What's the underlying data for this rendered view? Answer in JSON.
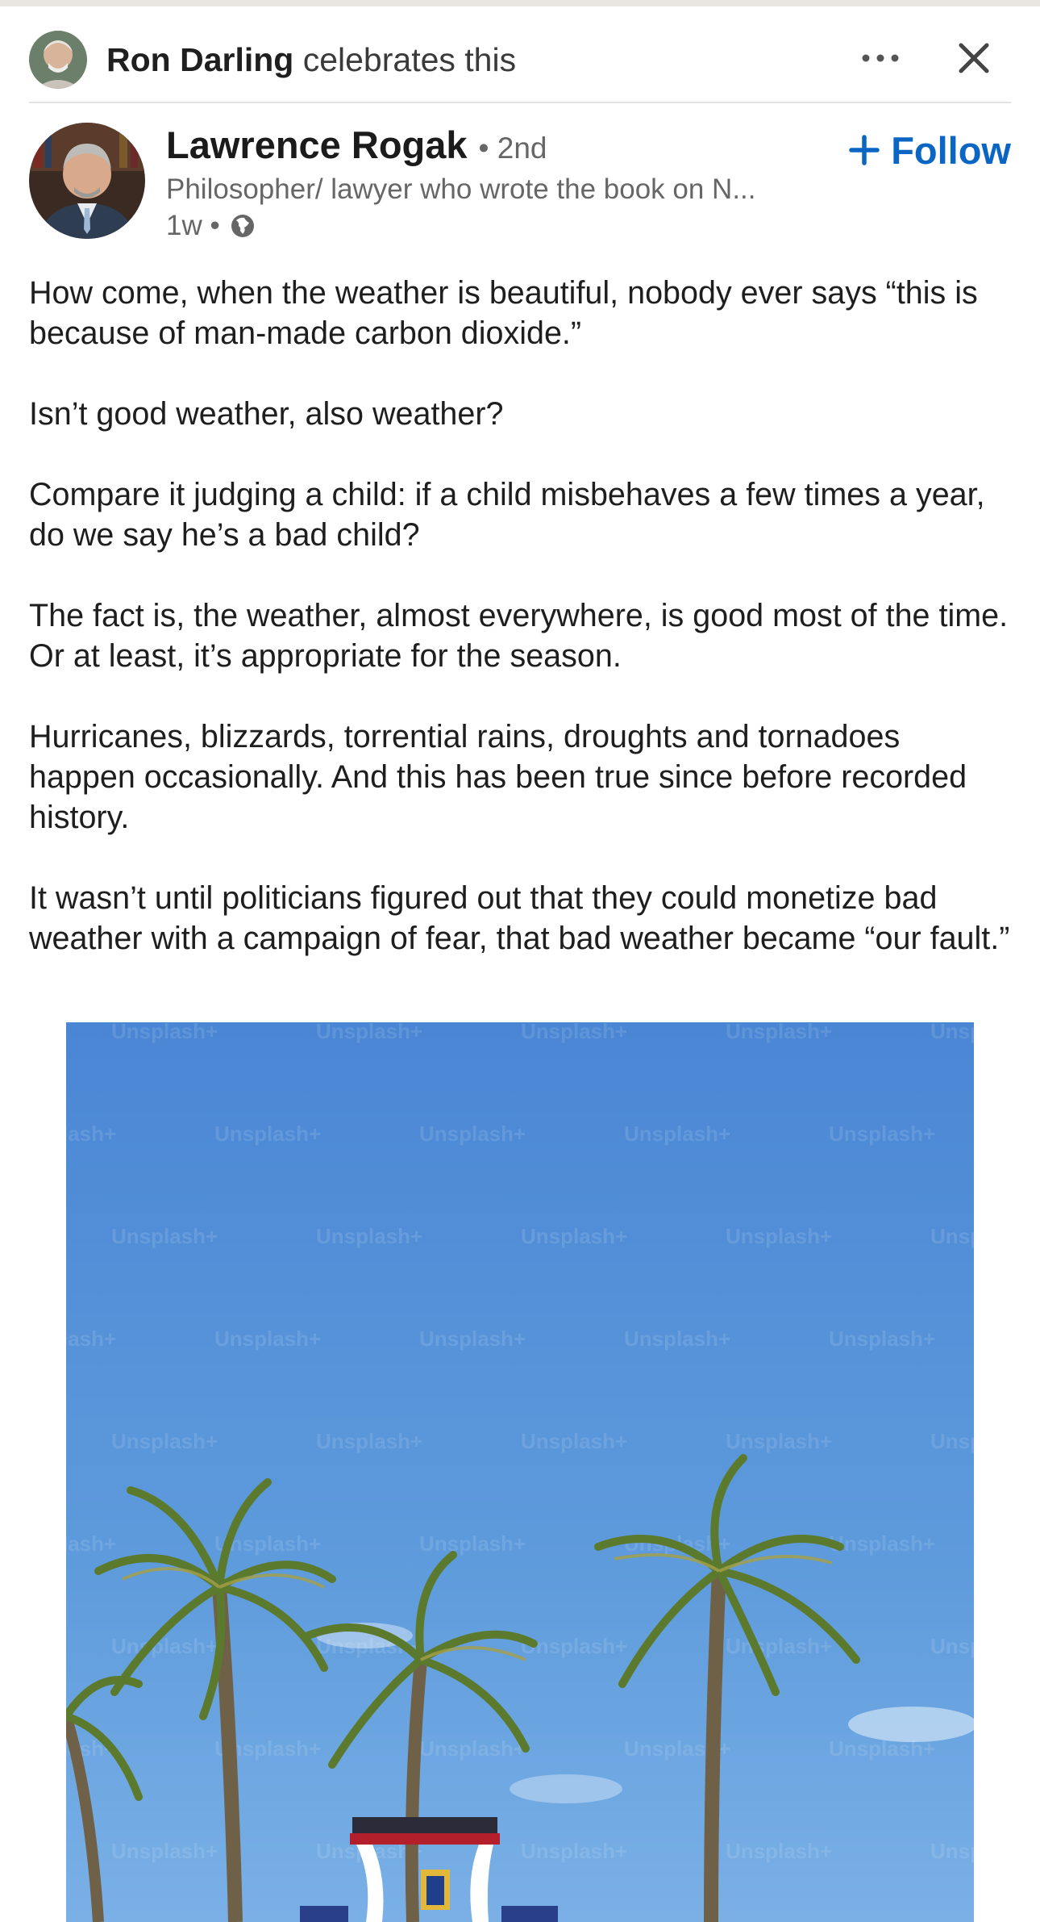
{
  "social_header": {
    "actor": "Ron Darling",
    "action": " celebrates this",
    "more_icon": "ellipsis-horizontal-icon",
    "close_icon": "close-icon"
  },
  "author": {
    "name": "Lawrence Rogak",
    "degree": "• 2nd",
    "headline": "Philosopher/ lawyer who wrote the book on N...",
    "time": "1w •",
    "visibility_icon": "globe-icon",
    "follow_label": "Follow",
    "follow_icon": "plus-icon"
  },
  "post": {
    "paragraphs": [
      "How come, when the weather is beautiful, nobody ever says “this is because of man-made carbon dioxide.”",
      "Isn’t good weather, also weather?",
      "Compare it judging a child: if a child misbehaves a few times a year, do we say he’s a bad child?",
      "The fact is, the weather, almost everywhere, is good most of the time.  Or at least, it’s appropriate for the season.",
      "Hurricanes, blizzards, torrential rains, droughts and tornadoes happen occasionally.  And this has been true since before recorded history.",
      "It wasn’t until politicians figured out that they could monetize bad weather with a campaign of fear, that bad weather became “our fault.”"
    ],
    "image_watermark": "Unsplash+"
  },
  "colors": {
    "link_blue": "#0a66c2",
    "sky_top": "#4a86d4",
    "sky_bottom": "#7ab0e6"
  }
}
